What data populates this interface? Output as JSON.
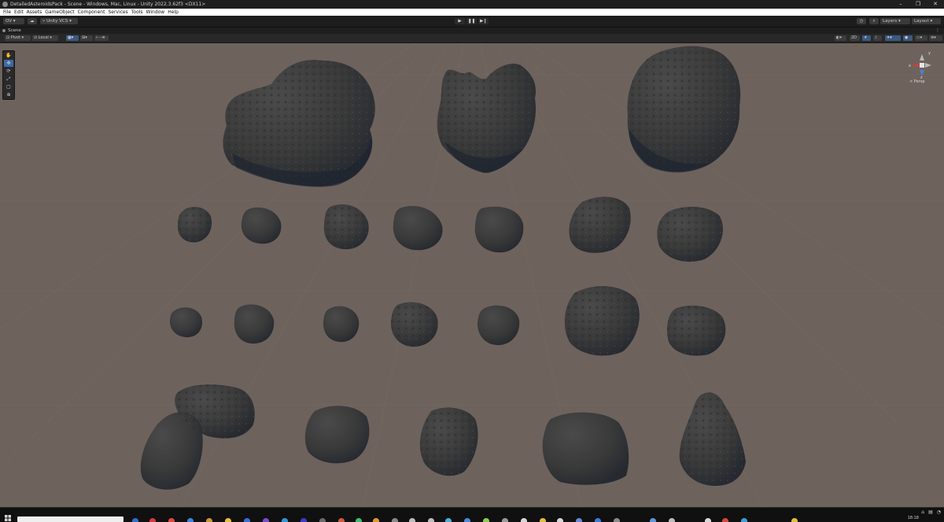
{
  "window": {
    "title": "DetailedAsteroidsPack - Scene - Windows, Mac, Linux - Unity 2022.3.62f3 <DX11>",
    "controls": [
      "–",
      "❐",
      "✕"
    ]
  },
  "menu": [
    "File",
    "Edit",
    "Assets",
    "GameObject",
    "Component",
    "Services",
    "Tools",
    "Window",
    "Help"
  ],
  "toolbar": {
    "account_label": "OV",
    "vcs_label": "Unity VCS",
    "play_icons": [
      "▶",
      "❚❚",
      "▶❙"
    ],
    "history_icon": "◷",
    "search_icon": "⌕",
    "layers_label": "Layers",
    "layout_label": "Layout"
  },
  "tab": {
    "label": "Scene",
    "more": "⋮"
  },
  "scene_toolbar": {
    "pivot_label": "Pivot",
    "local_label": "Local",
    "mode_2d": "2D"
  },
  "tools": [
    "✋",
    "✥",
    "⟳",
    "⤢",
    "▢",
    "⊕"
  ],
  "gizmo": {
    "x": "x",
    "y": "y",
    "z": "z",
    "persp_label": "< Persp"
  },
  "taskbar": {
    "clock": "18:18"
  },
  "colors": {
    "viewport_bg": "#6e625d",
    "asteroid": "#3a3a3a",
    "asteroid_shadow": "#1e2530",
    "active_tool": "#3d6aa8"
  }
}
